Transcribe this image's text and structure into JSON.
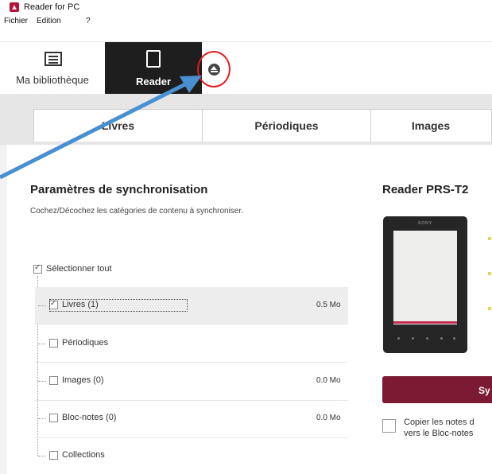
{
  "window": {
    "title": "Reader for PC"
  },
  "menu": {
    "file": "Fichier",
    "edit": "Edition",
    "help": "?"
  },
  "toolbar": {
    "library_label": "Ma bibliothèque",
    "reader_label": "Reader"
  },
  "tabs": [
    {
      "label": "Livres"
    },
    {
      "label": "Périodiques"
    },
    {
      "label": "Images"
    }
  ],
  "sync": {
    "title": "Paramètres de synchronisation",
    "subtitle": "Cochez/Décochez les catégories de contenu à synchroniser.",
    "select_all": {
      "label": "Sélectionner tout",
      "checked": true
    },
    "items": [
      {
        "label": "Livres (1)",
        "size": "0.5 Mo",
        "checked": true
      },
      {
        "label": "Périodiques",
        "size": "",
        "checked": false
      },
      {
        "label": "Images (0)",
        "size": "0.0 Mo",
        "checked": false
      },
      {
        "label": "Bloc-notes (0)",
        "size": "0.0 Mo",
        "checked": false
      },
      {
        "label": "Collections",
        "size": "",
        "checked": false
      }
    ]
  },
  "device": {
    "title": "Reader PRS-T2",
    "brand": "SONY",
    "sync_button": "Sy",
    "copy_notes": {
      "line1": "Copier les notes d",
      "line2": "vers le Bloc-notes",
      "checked": false
    }
  },
  "annotation": {
    "arrow_color": "#4a8fd0",
    "circle_color": "#e21d1d"
  }
}
